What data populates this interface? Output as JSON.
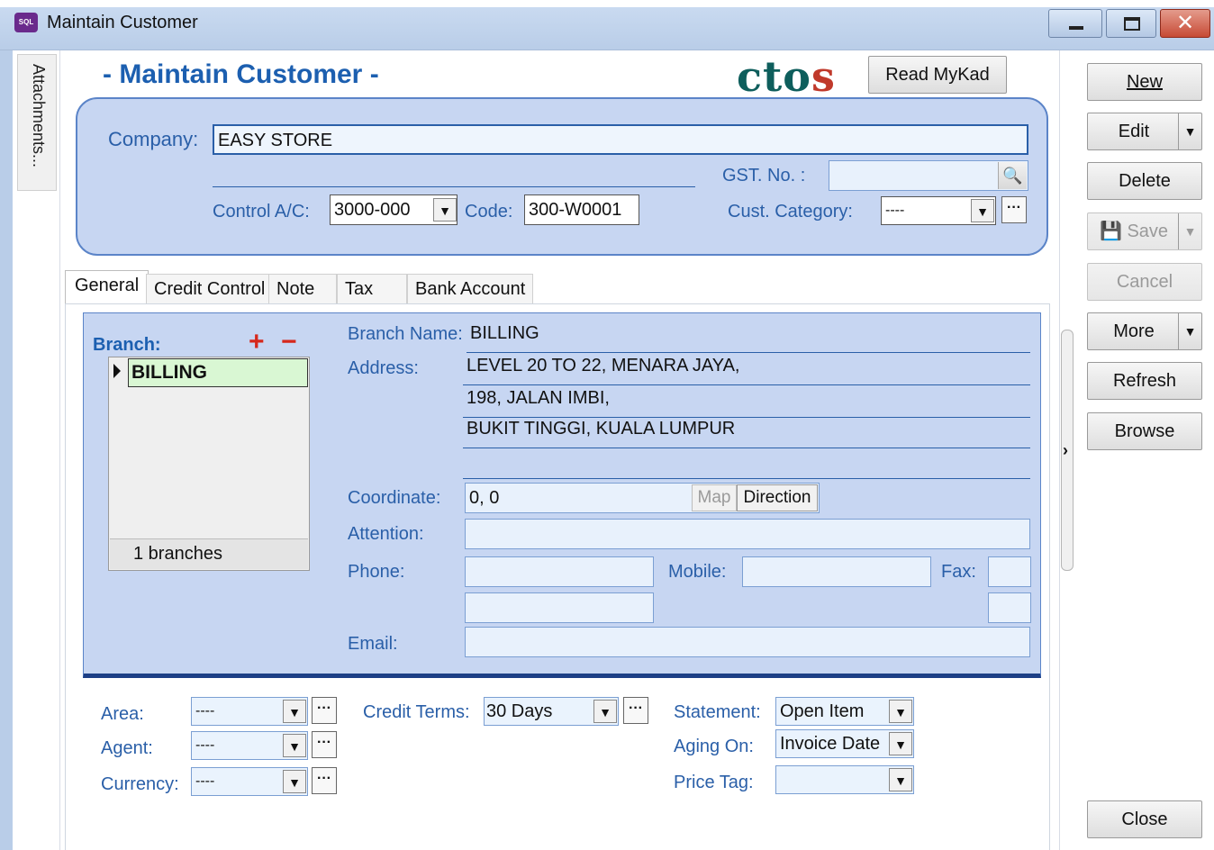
{
  "window": {
    "title": "Maintain Customer",
    "app_icon_text": "SQL"
  },
  "sidebar": {
    "attachments_label": "Attachments..."
  },
  "header": {
    "form_title": "- Maintain Customer -",
    "logo_text": "ctos",
    "read_mykad_label": "Read MyKad",
    "company_label": "Company:",
    "company_value": "EASY STORE",
    "gst_label": "GST. No. :",
    "gst_value": "",
    "control_label": "Control A/C:",
    "control_value": "3000-000",
    "code_label": "Code:",
    "code_value": "300-W0001",
    "category_label": "Cust. Category:",
    "category_value": "----"
  },
  "tabs": [
    "General",
    "Credit Control",
    "Note",
    "Tax",
    "Bank Account"
  ],
  "branch": {
    "title": "Branch:",
    "items": [
      "BILLING"
    ],
    "count_text": "1 branches",
    "name_label": "Branch Name:",
    "name_value": "BILLING",
    "address_label": "Address:",
    "address_lines": [
      "LEVEL 20 TO 22, MENARA JAYA,",
      "198, JALAN IMBI,",
      "BUKIT TINGGI, KUALA LUMPUR",
      ""
    ],
    "coordinate_label": "Coordinate:",
    "coordinate_value": "0, 0",
    "map_label": "Map",
    "direction_label": "Direction",
    "attention_label": "Attention:",
    "phone_label": "Phone:",
    "mobile_label": "Mobile:",
    "fax_label": "Fax:",
    "email_label": "Email:"
  },
  "bottom": {
    "area_label": "Area:",
    "area_value": "----",
    "agent_label": "Agent:",
    "agent_value": "----",
    "currency_label": "Currency:",
    "currency_value": "----",
    "terms_label": "Credit Terms:",
    "terms_value": "30 Days",
    "statement_label": "Statement:",
    "statement_value": "Open Item",
    "aging_label": "Aging On:",
    "aging_value": "Invoice Date",
    "price_label": "Price Tag:",
    "price_value": ""
  },
  "actions": {
    "new": "New",
    "edit": "Edit",
    "delete": "Delete",
    "save": "Save",
    "cancel": "Cancel",
    "more": "More",
    "refresh": "Refresh",
    "browse": "Browse",
    "close": "Close"
  },
  "colors": {
    "accent": "#1c5fb0",
    "panel": "#c7d6f2",
    "branch_selected": "#d9f7d3",
    "remove_add": "#d6281c"
  }
}
